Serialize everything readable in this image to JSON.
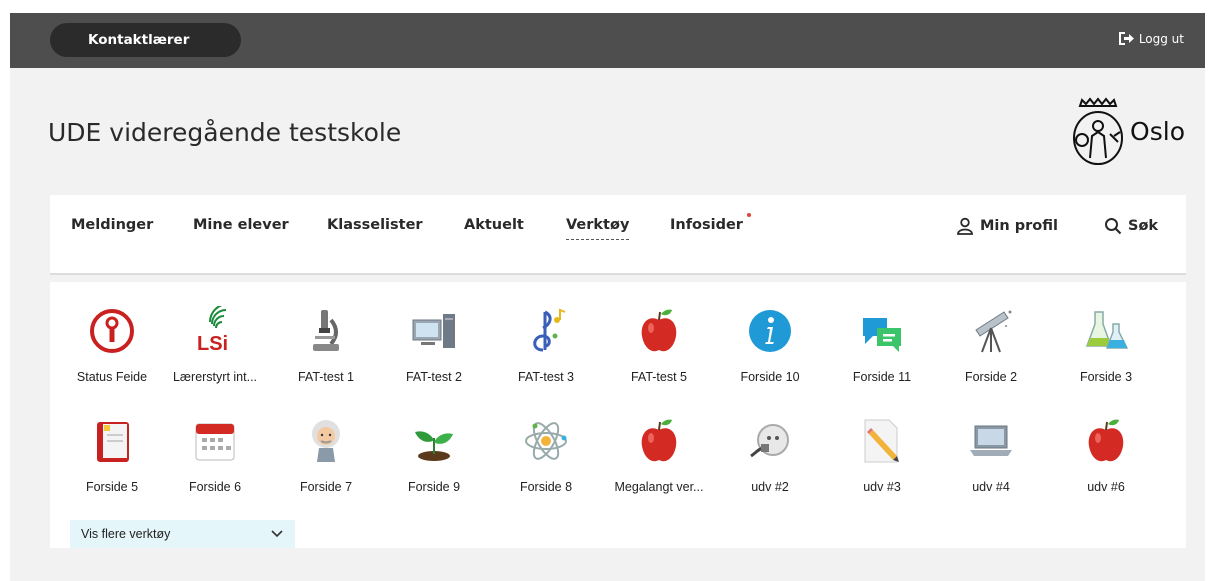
{
  "topbar": {
    "role_label": "Kontaktlærer",
    "logout_label": "Logg ut"
  },
  "header": {
    "school_title": "UDE videregående testskole",
    "logo_text": "Oslo"
  },
  "nav": {
    "items": [
      "Meldinger",
      "Mine elever",
      "Klasselister",
      "Aktuelt",
      "Verktøy",
      "Infosider"
    ],
    "active": "Verktøy",
    "profile_label": "Min profil",
    "search_label": "Søk"
  },
  "tools": {
    "row1": [
      {
        "label": "Status Feide",
        "icon": "status-feide-icon"
      },
      {
        "label": "Lærerstyrt int...",
        "icon": "lsi-icon"
      },
      {
        "label": "FAT-test 1",
        "icon": "microscope-icon"
      },
      {
        "label": "FAT-test 2",
        "icon": "computer-icon"
      },
      {
        "label": "FAT-test 3",
        "icon": "music-note-icon"
      },
      {
        "label": "FAT-test 5",
        "icon": "apple-icon"
      },
      {
        "label": "Forside 10",
        "icon": "info-icon"
      },
      {
        "label": "Forside 11",
        "icon": "chat-bubbles-icon"
      },
      {
        "label": "Forside 2",
        "icon": "telescope-icon"
      },
      {
        "label": "Forside 3",
        "icon": "flasks-icon"
      }
    ],
    "row2": [
      {
        "label": "Forside 5",
        "icon": "notebook-icon"
      },
      {
        "label": "Forside 6",
        "icon": "calendar-icon"
      },
      {
        "label": "Forside 7",
        "icon": "einstein-icon"
      },
      {
        "label": "Forside 9",
        "icon": "seedling-icon"
      },
      {
        "label": "Forside 8",
        "icon": "atom-icon"
      },
      {
        "label": "Megalangt ver...",
        "icon": "apple-icon"
      },
      {
        "label": "udv #2",
        "icon": "power-plug-icon"
      },
      {
        "label": "udv #3",
        "icon": "pencil-paper-icon"
      },
      {
        "label": "udv #4",
        "icon": "laptop-icon"
      },
      {
        "label": "udv #6",
        "icon": "apple-icon"
      }
    ],
    "more_label": "Vis flere verktøy"
  },
  "colors": {
    "topbar": "#4e4e4e",
    "pill": "#2b2b2b",
    "page_bg": "#f2f2f2",
    "notification_dot": "#e0413f",
    "more_button_bg": "#e5f6fa"
  }
}
